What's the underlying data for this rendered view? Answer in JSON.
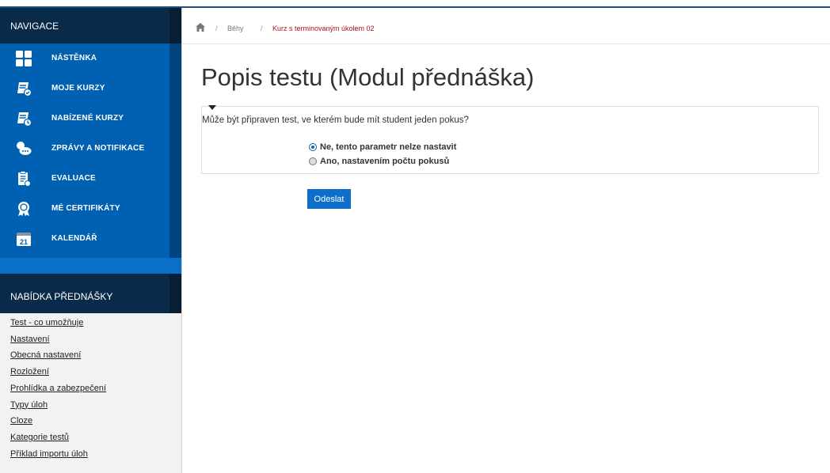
{
  "sidebar": {
    "nav_title": "NAVIGACE",
    "items": [
      {
        "label": "NÁSTĚNKA",
        "icon": "dashboard-icon"
      },
      {
        "label": "MOJE KURZY",
        "icon": "my-courses-icon"
      },
      {
        "label": "NABÍZENÉ KURZY",
        "icon": "offered-courses-icon"
      },
      {
        "label": "ZPRÁVY A NOTIFIKACE",
        "icon": "messages-icon"
      },
      {
        "label": "EVALUACE",
        "icon": "evaluation-icon"
      },
      {
        "label": "MÉ CERTIFIKÁTY",
        "icon": "certificate-icon"
      },
      {
        "label": "KALENDÁŘ",
        "icon": "calendar-icon",
        "day": "21"
      }
    ],
    "menu_title": "NABÍDKA PŘEDNÁŠKY",
    "links": [
      "Test - co umožňuje",
      "Nastavení",
      "Obecná nastavení",
      "Rozložení",
      "Prohlídka a zabezpečení",
      "Typy úloh",
      "Cloze",
      "Kategorie testů",
      "Příklad importu úloh"
    ]
  },
  "breadcrumb": {
    "home_icon": "home-icon",
    "sep": "/",
    "item1": "Běhy",
    "item2": "Kurz s terminovaným úkolem 02"
  },
  "main": {
    "title": "Popis testu (Modul přednáška)",
    "question": "Může být připraven test, ve kterém bude mít  student jeden pokus?",
    "options": [
      {
        "label": "Ne, tento parametr nelze nastavit",
        "selected": true
      },
      {
        "label": "Ano, nastavením počtu pokusů",
        "selected": false
      }
    ],
    "submit_label": "Odeslat"
  },
  "colors": {
    "nav_blue": "#0060b1",
    "nav_dark": "#0a2a4a",
    "button": "#0d6fca",
    "breadcrumb_link": "#b01020"
  }
}
